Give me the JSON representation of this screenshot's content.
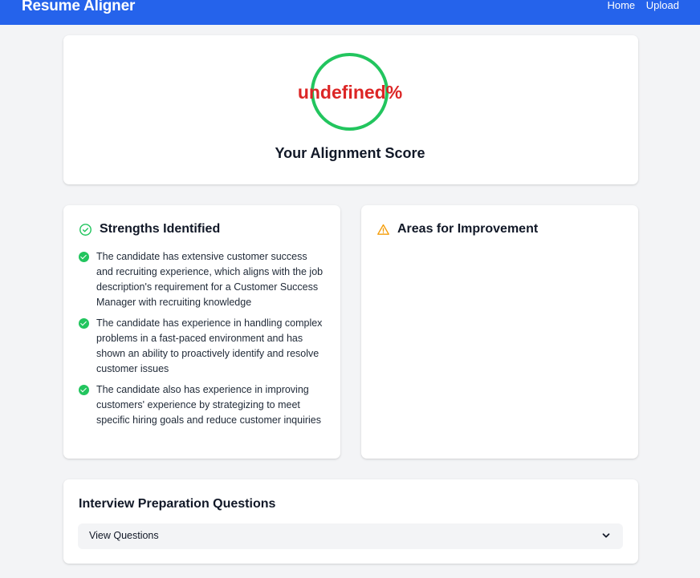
{
  "navbar": {
    "brand": "Resume Aligner",
    "links": [
      "Home",
      "Upload"
    ],
    "color": "#2563eb"
  },
  "score": {
    "value": "undefined%",
    "label": "Your Alignment Score",
    "ring_color": "#22c55e",
    "value_color": "#dc2626"
  },
  "strengths": {
    "title": "Strengths Identified",
    "icon": "check-circle-outline-icon",
    "items": [
      "The candidate has extensive customer success and recruiting experience, which aligns with the job description's requirement for a Customer Success Manager with recruiting knowledge",
      "The candidate has experience in handling complex problems in a fast-paced environment and has shown an ability to proactively identify and resolve customer issues",
      "The candidate also has experience in improving customers' experience by strategizing to meet specific hiring goals and reduce customer inquiries"
    ]
  },
  "improvements": {
    "title": "Areas for Improvement",
    "icon": "warning-triangle-icon",
    "items": []
  },
  "questions": {
    "title": "Interview Preparation Questions",
    "toggle_label": "View Questions",
    "toggle_icon": "chevron-down-icon"
  }
}
